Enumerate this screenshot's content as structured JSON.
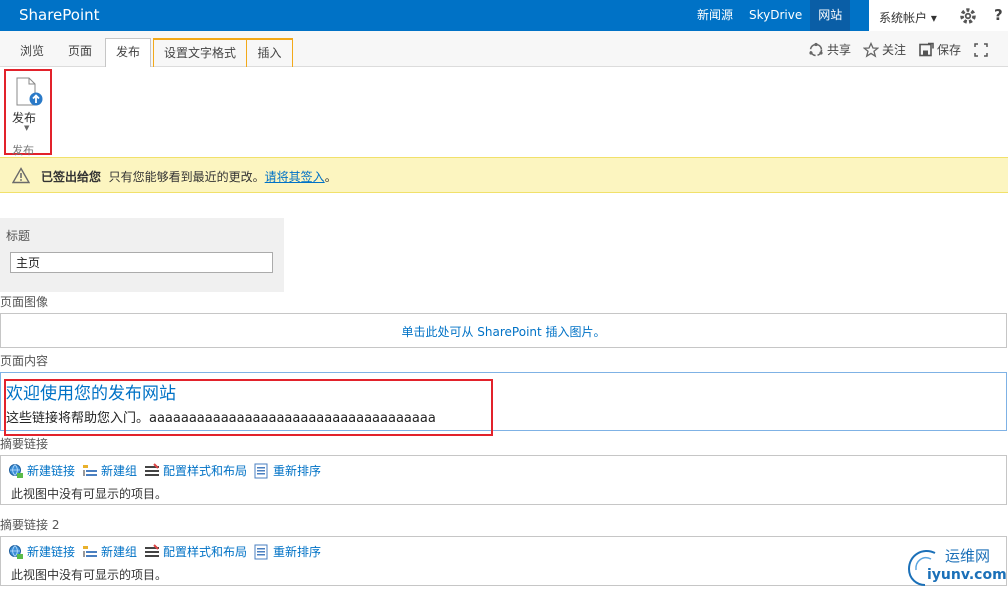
{
  "suite_bar": {
    "brand": "SharePoint",
    "links": [
      "新闻源",
      "SkyDrive",
      "网站"
    ],
    "account": "系统帐户 ▾",
    "help": "?"
  },
  "ribbon": {
    "tabs": [
      "浏览",
      "页面",
      "发布",
      "设置文字格式",
      "插入"
    ],
    "actions": [
      "共享",
      "关注",
      "保存"
    ],
    "publish_button": "发布",
    "group_label": "发布"
  },
  "status": {
    "bold": "已签出给您",
    "text": "只有您能够看到最近的更改。",
    "link": "请将其签入",
    "tail": "。"
  },
  "form": {
    "title_label": "标题",
    "title_value": "主页",
    "page_image_label": "页面图像",
    "page_image_link": "单击此处可从 SharePoint 插入图片。",
    "page_content_label": "页面内容",
    "content_heading": "欢迎使用您的发布网站",
    "content_body": "这些链接将帮助您入门。aaaaaaaaaaaaaaaaaaaaaaaaaaaaaaaaaaaa"
  },
  "summary_links": [
    {
      "label": "摘要链接",
      "toolbar": [
        "新建链接",
        "新建组",
        "配置样式和布局",
        "重新排序"
      ],
      "empty": "此视图中没有可显示的项目。"
    },
    {
      "label": "摘要链接 2",
      "toolbar": [
        "新建链接",
        "新建组",
        "配置样式和布局",
        "重新排序"
      ],
      "empty": "此视图中没有可显示的项目。"
    }
  ],
  "watermark": {
    "line1": "运维网",
    "line2": "iyunv.com"
  },
  "colors": {
    "suite": "#0072c6",
    "accent": "#0072c6",
    "highlight": "#e2222b",
    "status_bg": "#fcf5c0"
  }
}
